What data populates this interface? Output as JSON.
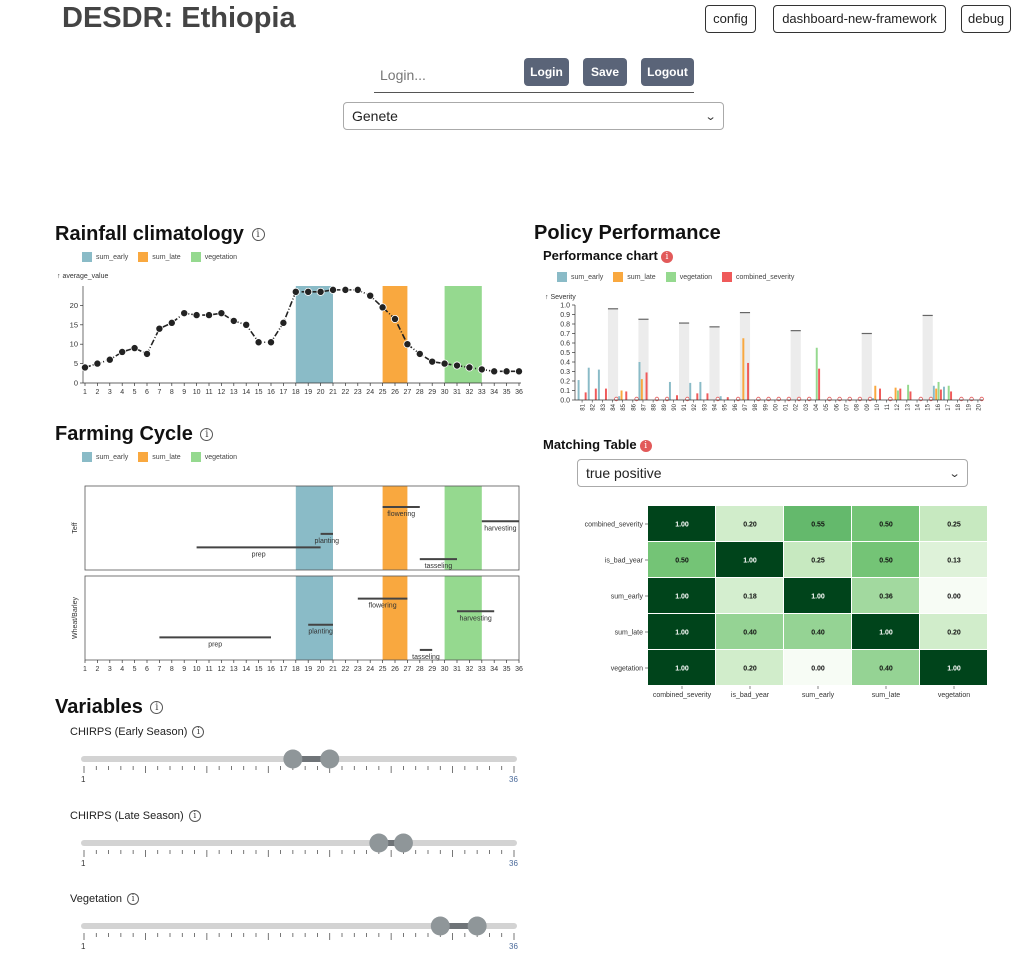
{
  "app": {
    "title": "DESDR: Ethiopia",
    "nav": {
      "config": "config",
      "dashboard": "dashboard-new-framework",
      "debug": "debug"
    }
  },
  "auth": {
    "login_placeholder": "Login...",
    "login": "Login",
    "save": "Save",
    "logout": "Logout"
  },
  "region_select": {
    "selected": "Genete"
  },
  "colors": {
    "sum_early": "#8abbc7",
    "sum_late": "#f9a83f",
    "vegetation": "#95d98f",
    "combined_severity": "#ef5a5a"
  },
  "rainfall": {
    "title": "Rainfall climatology",
    "legend": [
      "sum_early",
      "sum_late",
      "vegetation"
    ],
    "chart_data": {
      "type": "line",
      "ylabel": "↑ average_value",
      "ylim": [
        0,
        25
      ],
      "yticks": [
        0,
        5,
        10,
        15,
        20
      ],
      "x": [
        1,
        2,
        3,
        4,
        5,
        6,
        7,
        8,
        9,
        10,
        11,
        12,
        13,
        14,
        15,
        16,
        17,
        18,
        19,
        20,
        21,
        22,
        23,
        24,
        25,
        26,
        27,
        28,
        29,
        30,
        31,
        32,
        33,
        34,
        35,
        36
      ],
      "values": [
        4,
        5,
        6,
        8,
        9,
        7.5,
        14,
        15.5,
        18,
        17.5,
        17.5,
        18,
        16,
        15,
        10.5,
        10.5,
        15.5,
        23.5,
        23.5,
        23.5,
        24,
        24,
        24,
        22.5,
        19.5,
        16.5,
        10,
        7.5,
        5.5,
        5,
        4.5,
        4,
        3.5,
        3,
        3,
        3
      ],
      "bands": [
        {
          "name": "sum_early",
          "from": 18,
          "to": 21
        },
        {
          "name": "sum_late",
          "from": 25,
          "to": 27
        },
        {
          "name": "vegetation",
          "from": 30,
          "to": 33
        }
      ]
    }
  },
  "farming": {
    "title": "Farming Cycle",
    "legend": [
      "sum_early",
      "sum_late",
      "vegetation"
    ],
    "chart_data": {
      "type": "gantt",
      "x_range": [
        1,
        36
      ],
      "bands": [
        {
          "name": "sum_early",
          "from": 18,
          "to": 21
        },
        {
          "name": "sum_late",
          "from": 25,
          "to": 27
        },
        {
          "name": "vegetation",
          "from": 30,
          "to": 33
        }
      ],
      "crops": [
        {
          "name": "Teff",
          "stages": [
            {
              "label": "prep",
              "from": 10,
              "to": 20
            },
            {
              "label": "planting",
              "from": 20,
              "to": 21
            },
            {
              "label": "flowering",
              "from": 25,
              "to": 28
            },
            {
              "label": "tasseling",
              "from": 28,
              "to": 31
            },
            {
              "label": "harvesting",
              "from": 33,
              "to": 36
            }
          ]
        },
        {
          "name": "Wheat/Barley",
          "stages": [
            {
              "label": "prep",
              "from": 7,
              "to": 16
            },
            {
              "label": "planting",
              "from": 19,
              "to": 21
            },
            {
              "label": "flowering",
              "from": 23,
              "to": 27
            },
            {
              "label": "tasseling",
              "from": 28,
              "to": 29
            },
            {
              "label": "harvesting",
              "from": 31,
              "to": 34
            }
          ]
        }
      ]
    }
  },
  "variables": {
    "title": "Variables",
    "sliders": [
      {
        "label": "CHIRPS (Early Season)",
        "min": 1,
        "max": 36,
        "low": 18,
        "high": 21,
        "min_label": "1",
        "max_label": "36"
      },
      {
        "label": "CHIRPS (Late Season)",
        "min": 1,
        "max": 36,
        "low": 25,
        "high": 27,
        "min_label": "1",
        "max_label": "36"
      },
      {
        "label": "Vegetation",
        "min": 1,
        "max": 36,
        "low": 30,
        "high": 33,
        "min_label": "1",
        "max_label": "36"
      }
    ]
  },
  "policy": {
    "title": "Policy Performance",
    "performance_title": "Performance chart",
    "legend": [
      "sum_early",
      "sum_late",
      "vegetation",
      "combined_severity"
    ],
    "chart_data": {
      "type": "bar",
      "ylabel": "↑ Severity",
      "ylim": [
        0,
        1
      ],
      "yticks": [
        "0.0",
        "0.1",
        "0.2",
        "0.3",
        "0.4",
        "0.5",
        "0.6",
        "0.7",
        "0.8",
        "0.9",
        "1.0"
      ],
      "categories": [
        "81",
        "82",
        "83",
        "84",
        "85",
        "86",
        "87",
        "88",
        "89",
        "90",
        "91",
        "92",
        "93",
        "94",
        "95",
        "96",
        "97",
        "98",
        "99",
        "00",
        "01",
        "02",
        "03",
        "04",
        "05",
        "06",
        "07",
        "08",
        "09",
        "10",
        "11",
        "12",
        "13",
        "14",
        "15",
        "16",
        "17",
        "18",
        "19",
        "20"
      ],
      "series": [
        {
          "name": "sum_early",
          "values": [
            0.21,
            0.34,
            0.32,
            0,
            0.04,
            0,
            0.4,
            0,
            0,
            0.19,
            0,
            0.18,
            0.19,
            0,
            0.04,
            0,
            0,
            0,
            0,
            0,
            0,
            0,
            0,
            0,
            0,
            0,
            0,
            0,
            0,
            0.02,
            0,
            0,
            0,
            0,
            0,
            0.15,
            0.14,
            0,
            0,
            0
          ]
        },
        {
          "name": "sum_late",
          "values": [
            0,
            0,
            0,
            0,
            0.1,
            0,
            0.22,
            0,
            0,
            0,
            0,
            0,
            0,
            0,
            0,
            0,
            0.65,
            0,
            0,
            0,
            0,
            0,
            0,
            0,
            0,
            0,
            0,
            0,
            0,
            0.15,
            0,
            0.13,
            0,
            0,
            0,
            0.12,
            0,
            0,
            0,
            0
          ]
        },
        {
          "name": "vegetation",
          "values": [
            0,
            0,
            0,
            0,
            0,
            0,
            0,
            0,
            0,
            0,
            0,
            0,
            0,
            0,
            0,
            0,
            0,
            0,
            0,
            0,
            0,
            0,
            0,
            0.55,
            0,
            0,
            0,
            0,
            0,
            0,
            0,
            0.1,
            0.16,
            0,
            0,
            0.19,
            0.15,
            0,
            0,
            0
          ]
        },
        {
          "name": "combined_severity",
          "values": [
            0.08,
            0.12,
            0.12,
            0,
            0.09,
            0,
            0.29,
            0,
            0,
            0.05,
            0,
            0.07,
            0.07,
            0,
            0.03,
            0,
            0.39,
            0.01,
            0,
            0,
            0,
            0,
            0,
            0.33,
            0,
            0,
            0,
            0,
            0,
            0.12,
            0,
            0.12,
            0.09,
            0,
            0,
            0.11,
            0.09,
            0,
            0,
            0
          ]
        }
      ],
      "bad_years": [
        {
          "category": "84",
          "value": 0.96
        },
        {
          "category": "87",
          "value": 0.85
        },
        {
          "category": "91",
          "value": 0.81
        },
        {
          "category": "94",
          "value": 0.77
        },
        {
          "category": "97",
          "value": 0.92
        },
        {
          "category": "02",
          "value": 0.73
        },
        {
          "category": "09",
          "value": 0.7
        },
        {
          "category": "15",
          "value": 0.89
        }
      ]
    }
  },
  "matching": {
    "title": "Matching Table",
    "selected": "true positive",
    "chart_data": {
      "type": "heatmap",
      "rows": [
        "combined_severity",
        "is_bad_year",
        "sum_early",
        "sum_late",
        "vegetation"
      ],
      "cols": [
        "combined_severity",
        "is_bad_year",
        "sum_early",
        "sum_late",
        "vegetation"
      ],
      "values": [
        [
          1.0,
          0.2,
          0.55,
          0.5,
          0.25
        ],
        [
          0.5,
          1.0,
          0.25,
          0.5,
          0.13
        ],
        [
          1.0,
          0.18,
          1.0,
          0.36,
          0.0
        ],
        [
          1.0,
          0.4,
          0.4,
          1.0,
          0.2
        ],
        [
          1.0,
          0.2,
          0.0,
          0.4,
          1.0
        ]
      ],
      "labels": [
        [
          "1.00",
          "0.20",
          "0.55",
          "0.50",
          "0.25"
        ],
        [
          "0.50",
          "1.00",
          "0.25",
          "0.50",
          "0.13"
        ],
        [
          "1.00",
          "0.18",
          "1.00",
          "0.36",
          "0.00"
        ],
        [
          "1.00",
          "0.40",
          "0.40",
          "1.00",
          "0.20"
        ],
        [
          "1.00",
          "0.20",
          "0.00",
          "0.40",
          "1.00"
        ]
      ]
    }
  }
}
